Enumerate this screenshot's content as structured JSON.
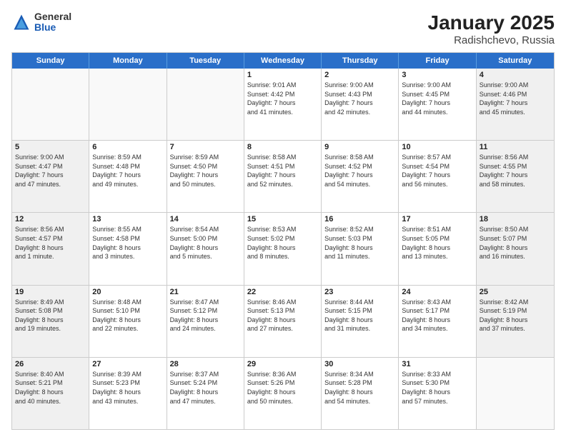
{
  "header": {
    "logo_general": "General",
    "logo_blue": "Blue",
    "title": "January 2025",
    "subtitle": "Radishchevo, Russia"
  },
  "weekdays": [
    "Sunday",
    "Monday",
    "Tuesday",
    "Wednesday",
    "Thursday",
    "Friday",
    "Saturday"
  ],
  "rows": [
    [
      {
        "day": "",
        "info": ""
      },
      {
        "day": "",
        "info": ""
      },
      {
        "day": "",
        "info": ""
      },
      {
        "day": "1",
        "info": "Sunrise: 9:01 AM\nSunset: 4:42 PM\nDaylight: 7 hours\nand 41 minutes."
      },
      {
        "day": "2",
        "info": "Sunrise: 9:00 AM\nSunset: 4:43 PM\nDaylight: 7 hours\nand 42 minutes."
      },
      {
        "day": "3",
        "info": "Sunrise: 9:00 AM\nSunset: 4:45 PM\nDaylight: 7 hours\nand 44 minutes."
      },
      {
        "day": "4",
        "info": "Sunrise: 9:00 AM\nSunset: 4:46 PM\nDaylight: 7 hours\nand 45 minutes."
      }
    ],
    [
      {
        "day": "5",
        "info": "Sunrise: 9:00 AM\nSunset: 4:47 PM\nDaylight: 7 hours\nand 47 minutes."
      },
      {
        "day": "6",
        "info": "Sunrise: 8:59 AM\nSunset: 4:48 PM\nDaylight: 7 hours\nand 49 minutes."
      },
      {
        "day": "7",
        "info": "Sunrise: 8:59 AM\nSunset: 4:50 PM\nDaylight: 7 hours\nand 50 minutes."
      },
      {
        "day": "8",
        "info": "Sunrise: 8:58 AM\nSunset: 4:51 PM\nDaylight: 7 hours\nand 52 minutes."
      },
      {
        "day": "9",
        "info": "Sunrise: 8:58 AM\nSunset: 4:52 PM\nDaylight: 7 hours\nand 54 minutes."
      },
      {
        "day": "10",
        "info": "Sunrise: 8:57 AM\nSunset: 4:54 PM\nDaylight: 7 hours\nand 56 minutes."
      },
      {
        "day": "11",
        "info": "Sunrise: 8:56 AM\nSunset: 4:55 PM\nDaylight: 7 hours\nand 58 minutes."
      }
    ],
    [
      {
        "day": "12",
        "info": "Sunrise: 8:56 AM\nSunset: 4:57 PM\nDaylight: 8 hours\nand 1 minute."
      },
      {
        "day": "13",
        "info": "Sunrise: 8:55 AM\nSunset: 4:58 PM\nDaylight: 8 hours\nand 3 minutes."
      },
      {
        "day": "14",
        "info": "Sunrise: 8:54 AM\nSunset: 5:00 PM\nDaylight: 8 hours\nand 5 minutes."
      },
      {
        "day": "15",
        "info": "Sunrise: 8:53 AM\nSunset: 5:02 PM\nDaylight: 8 hours\nand 8 minutes."
      },
      {
        "day": "16",
        "info": "Sunrise: 8:52 AM\nSunset: 5:03 PM\nDaylight: 8 hours\nand 11 minutes."
      },
      {
        "day": "17",
        "info": "Sunrise: 8:51 AM\nSunset: 5:05 PM\nDaylight: 8 hours\nand 13 minutes."
      },
      {
        "day": "18",
        "info": "Sunrise: 8:50 AM\nSunset: 5:07 PM\nDaylight: 8 hours\nand 16 minutes."
      }
    ],
    [
      {
        "day": "19",
        "info": "Sunrise: 8:49 AM\nSunset: 5:08 PM\nDaylight: 8 hours\nand 19 minutes."
      },
      {
        "day": "20",
        "info": "Sunrise: 8:48 AM\nSunset: 5:10 PM\nDaylight: 8 hours\nand 22 minutes."
      },
      {
        "day": "21",
        "info": "Sunrise: 8:47 AM\nSunset: 5:12 PM\nDaylight: 8 hours\nand 24 minutes."
      },
      {
        "day": "22",
        "info": "Sunrise: 8:46 AM\nSunset: 5:13 PM\nDaylight: 8 hours\nand 27 minutes."
      },
      {
        "day": "23",
        "info": "Sunrise: 8:44 AM\nSunset: 5:15 PM\nDaylight: 8 hours\nand 31 minutes."
      },
      {
        "day": "24",
        "info": "Sunrise: 8:43 AM\nSunset: 5:17 PM\nDaylight: 8 hours\nand 34 minutes."
      },
      {
        "day": "25",
        "info": "Sunrise: 8:42 AM\nSunset: 5:19 PM\nDaylight: 8 hours\nand 37 minutes."
      }
    ],
    [
      {
        "day": "26",
        "info": "Sunrise: 8:40 AM\nSunset: 5:21 PM\nDaylight: 8 hours\nand 40 minutes."
      },
      {
        "day": "27",
        "info": "Sunrise: 8:39 AM\nSunset: 5:23 PM\nDaylight: 8 hours\nand 43 minutes."
      },
      {
        "day": "28",
        "info": "Sunrise: 8:37 AM\nSunset: 5:24 PM\nDaylight: 8 hours\nand 47 minutes."
      },
      {
        "day": "29",
        "info": "Sunrise: 8:36 AM\nSunset: 5:26 PM\nDaylight: 8 hours\nand 50 minutes."
      },
      {
        "day": "30",
        "info": "Sunrise: 8:34 AM\nSunset: 5:28 PM\nDaylight: 8 hours\nand 54 minutes."
      },
      {
        "day": "31",
        "info": "Sunrise: 8:33 AM\nSunset: 5:30 PM\nDaylight: 8 hours\nand 57 minutes."
      },
      {
        "day": "",
        "info": ""
      }
    ]
  ]
}
